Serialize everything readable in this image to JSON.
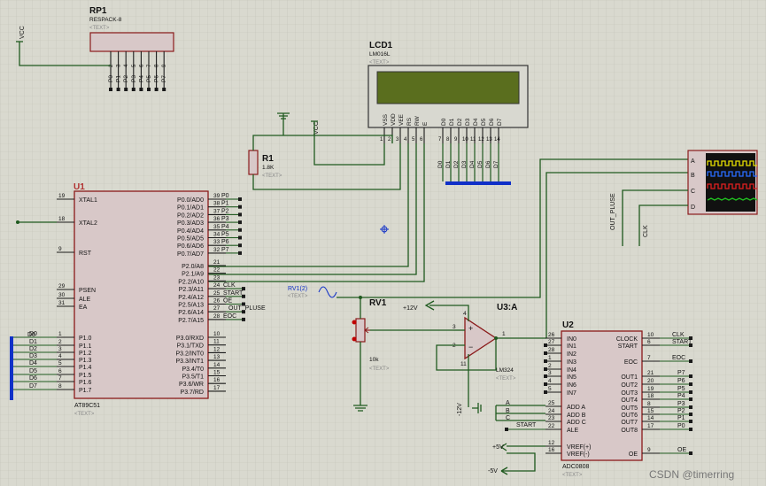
{
  "rp1": {
    "ref": "RP1",
    "value": "RESPACK-8",
    "text": "<TEXT>",
    "pins": [
      "P0",
      "P1",
      "P2",
      "P3",
      "P4",
      "P5",
      "P6",
      "P7"
    ],
    "pin_nums": [
      "2",
      "3",
      "4",
      "5",
      "6",
      "7",
      "8",
      "9"
    ]
  },
  "vcc_label": "VCC",
  "lcd": {
    "ref": "LCD1",
    "model": "LM016L",
    "text": "<TEXT>",
    "pins": [
      "VSS",
      "VDD",
      "VEE",
      "RS",
      "RW",
      "E",
      "D0",
      "D1",
      "D2",
      "D3",
      "D4",
      "D5",
      "D6",
      "D7"
    ],
    "pin_nums": [
      "1",
      "2",
      "3",
      "4",
      "5",
      "6",
      "7",
      "8",
      "9",
      "10",
      "11",
      "12",
      "13",
      "14"
    ],
    "bus_labels": [
      "D0",
      "D1",
      "D2",
      "D3",
      "D4",
      "D5",
      "D6",
      "D7"
    ]
  },
  "r1": {
    "ref": "R1",
    "value": "1.8K",
    "text": "<TEXT>"
  },
  "u1": {
    "ref": "U1",
    "model": "AT89C51",
    "text": "<TEXT>",
    "left_pins": [
      {
        "num": "19",
        "name": "XTAL1"
      },
      {
        "num": "18",
        "name": "XTAL2"
      },
      {
        "num": "9",
        "name": "RST"
      },
      {
        "num": "29",
        "name": "PSEN"
      },
      {
        "num": "30",
        "name": "ALE"
      },
      {
        "num": "31",
        "name": "EA"
      },
      {
        "num": "1",
        "name": "P1.0"
      },
      {
        "num": "2",
        "name": "P1.1"
      },
      {
        "num": "3",
        "name": "P1.2"
      },
      {
        "num": "4",
        "name": "P1.3"
      },
      {
        "num": "5",
        "name": "P1.4"
      },
      {
        "num": "6",
        "name": "P1.5"
      },
      {
        "num": "7",
        "name": "P1.6"
      },
      {
        "num": "8",
        "name": "P1.7"
      }
    ],
    "right_pins": [
      {
        "num": "39",
        "name": "P0.0/AD0",
        "net": "P0"
      },
      {
        "num": "38",
        "name": "P0.1/AD1",
        "net": "P1"
      },
      {
        "num": "37",
        "name": "P0.2/AD2",
        "net": "P2"
      },
      {
        "num": "36",
        "name": "P0.3/AD3",
        "net": "P3"
      },
      {
        "num": "35",
        "name": "P0.4/AD4",
        "net": "P4"
      },
      {
        "num": "34",
        "name": "P0.5/AD5",
        "net": "P5"
      },
      {
        "num": "33",
        "name": "P0.6/AD6",
        "net": "P6"
      },
      {
        "num": "32",
        "name": "P0.7/AD7",
        "net": "P7"
      },
      {
        "num": "21",
        "name": "P2.0/A8",
        "net": ""
      },
      {
        "num": "22",
        "name": "P2.1/A9",
        "net": ""
      },
      {
        "num": "23",
        "name": "P2.2/A10",
        "net": ""
      },
      {
        "num": "24",
        "name": "P2.3/A11",
        "net": "CLK"
      },
      {
        "num": "25",
        "name": "P2.4/A12",
        "net": "START"
      },
      {
        "num": "26",
        "name": "P2.5/A13",
        "net": "OE"
      },
      {
        "num": "27",
        "name": "P2.6/A14",
        "net": "OUT_PLUSE"
      },
      {
        "num": "28",
        "name": "P2.7/A15",
        "net": "EOC"
      },
      {
        "num": "10",
        "name": "P3.0/RXD",
        "net": ""
      },
      {
        "num": "11",
        "name": "P3.1/TXD",
        "net": ""
      },
      {
        "num": "12",
        "name": "P3.2/INT0",
        "net": ""
      },
      {
        "num": "13",
        "name": "P3.3/INT1",
        "net": ""
      },
      {
        "num": "14",
        "name": "P3.4/T0",
        "net": ""
      },
      {
        "num": "15",
        "name": "P3.5/T1",
        "net": ""
      },
      {
        "num": "16",
        "name": "P3.6/WR",
        "net": ""
      },
      {
        "num": "17",
        "name": "P3.7/RD",
        "net": ""
      }
    ],
    "p1_nets": [
      "D0",
      "D1",
      "D2",
      "D3",
      "D4",
      "D5",
      "D6",
      "D7"
    ]
  },
  "rv1_src": {
    "ref": "RV1(2)",
    "text": "<TEXT>"
  },
  "rv1": {
    "ref": "RV1",
    "value": "10k",
    "text": "<TEXT>"
  },
  "u3": {
    "ref": "U3:A",
    "model": "LM324",
    "text": "<TEXT>",
    "pins": [
      "3",
      "2",
      "1",
      "4",
      "11"
    ],
    "plus12": "+12V",
    "minus12": "-12V",
    "plus": "+",
    "minus": "−"
  },
  "u2": {
    "ref": "U2",
    "model": "ADC0808",
    "text": "<TEXT>",
    "left_pins": [
      {
        "num": "26",
        "name": "IN0"
      },
      {
        "num": "27",
        "name": "IN1"
      },
      {
        "num": "28",
        "name": "IN2"
      },
      {
        "num": "1",
        "name": "IN3"
      },
      {
        "num": "2",
        "name": "IN4"
      },
      {
        "num": "3",
        "name": "IN5"
      },
      {
        "num": "4",
        "name": "IN6"
      },
      {
        "num": "5",
        "name": "IN7"
      },
      {
        "num": "25",
        "name": "ADD A"
      },
      {
        "num": "24",
        "name": "ADD B"
      },
      {
        "num": "23",
        "name": "ADD C"
      },
      {
        "num": "22",
        "name": "ALE"
      },
      {
        "num": "12",
        "name": "VREF(+)"
      },
      {
        "num": "16",
        "name": "VREF(-)"
      }
    ],
    "right_pins": [
      {
        "num": "10",
        "name": "CLOCK",
        "net": "CLK"
      },
      {
        "num": "6",
        "name": "START",
        "net": "START"
      },
      {
        "num": "7",
        "name": "EOC",
        "net": "EOC"
      },
      {
        "num": "21",
        "name": "OUT1",
        "net": "P7"
      },
      {
        "num": "20",
        "name": "OUT2",
        "net": "P6"
      },
      {
        "num": "19",
        "name": "OUT3",
        "net": "P5"
      },
      {
        "num": "18",
        "name": "OUT4",
        "net": "P4"
      },
      {
        "num": "8",
        "name": "OUT5",
        "net": "P3"
      },
      {
        "num": "15",
        "name": "OUT6",
        "net": "P2"
      },
      {
        "num": "14",
        "name": "OUT7",
        "net": "P1"
      },
      {
        "num": "17",
        "name": "OUT8",
        "net": "P0"
      },
      {
        "num": "9",
        "name": "OE",
        "net": "OE"
      }
    ],
    "addr_nets": [
      "A",
      "B",
      "C",
      "START"
    ],
    "vref_plus": "+5V",
    "vref_minus": "-5V"
  },
  "scope": {
    "channels": [
      "A",
      "B",
      "C",
      "D"
    ],
    "out_label": "OUT_PLUSE",
    "clk_label": "CLK",
    "colors": [
      "#e8e000",
      "#2a6cff",
      "#e02020",
      "#20c020"
    ]
  },
  "watermark": "CSDN @timerring",
  "colors": {
    "background": "#d9d9cf",
    "wire": "#1f5a1f",
    "body": "#d8c8c8",
    "outline": "#8a1a1a",
    "bus": "#1030c8",
    "lcd_screen": "#5a6e1e"
  }
}
